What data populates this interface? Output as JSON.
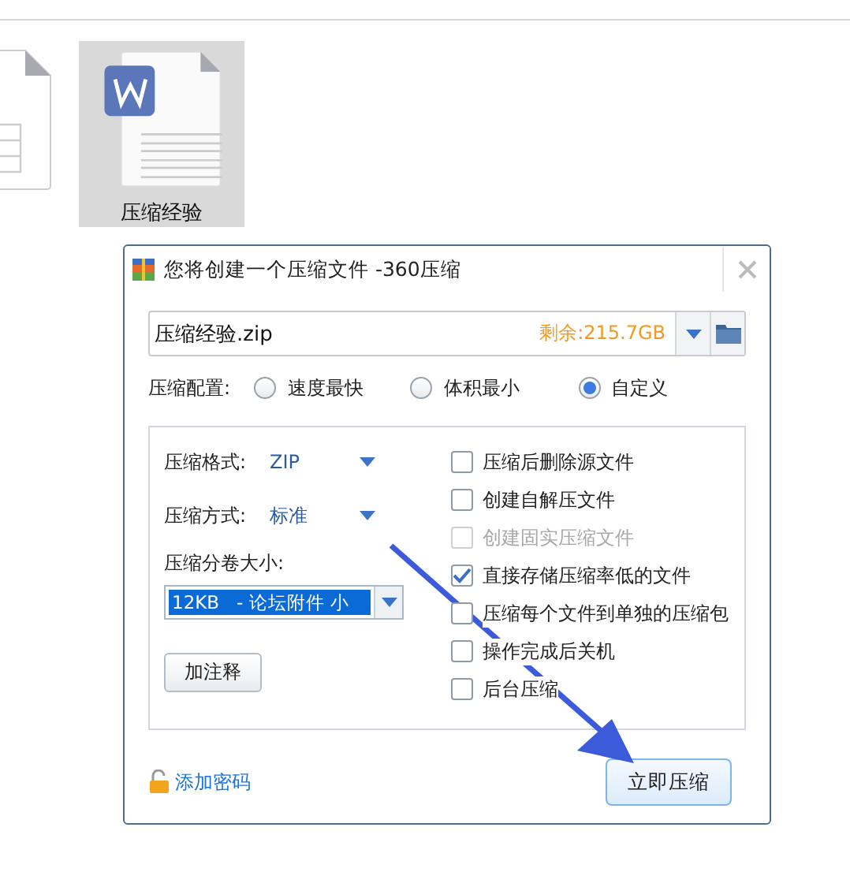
{
  "files": [
    {
      "kind": "spreadsheet",
      "selected": false
    },
    {
      "name": "压缩经验",
      "kind": "document",
      "selected": true
    }
  ],
  "dialog": {
    "title": "您将创建一个压缩文件 -360压缩",
    "filename": "压缩经验.zip",
    "free_space": "剩余:215.7GB",
    "profile_label": "压缩配置:",
    "profiles": [
      {
        "label": "速度最快",
        "selected": false
      },
      {
        "label": "体积最小",
        "selected": false
      },
      {
        "label": "自定义",
        "selected": true
      }
    ],
    "format": {
      "label": "压缩格式:",
      "value": "ZIP"
    },
    "method": {
      "label": "压缩方式:",
      "value": "标准"
    },
    "split": {
      "label": "压缩分卷大小:",
      "value": "12KB   - 论坛附件 小"
    },
    "comment_button": "加注释",
    "options": [
      {
        "label": "压缩后删除源文件",
        "checked": false,
        "disabled": false
      },
      {
        "label": "创建自解压文件",
        "checked": false,
        "disabled": false
      },
      {
        "label": "创建固实压缩文件",
        "checked": false,
        "disabled": true
      },
      {
        "label": "直接存储压缩率低的文件",
        "checked": true,
        "disabled": false
      },
      {
        "label": "压缩每个文件到单独的压缩包",
        "checked": false,
        "disabled": false
      },
      {
        "label": "操作完成后关机",
        "checked": false,
        "disabled": false
      },
      {
        "label": "后台压缩",
        "checked": false,
        "disabled": false
      }
    ],
    "password_link": "添加密码",
    "compress_button": "立即压缩"
  }
}
